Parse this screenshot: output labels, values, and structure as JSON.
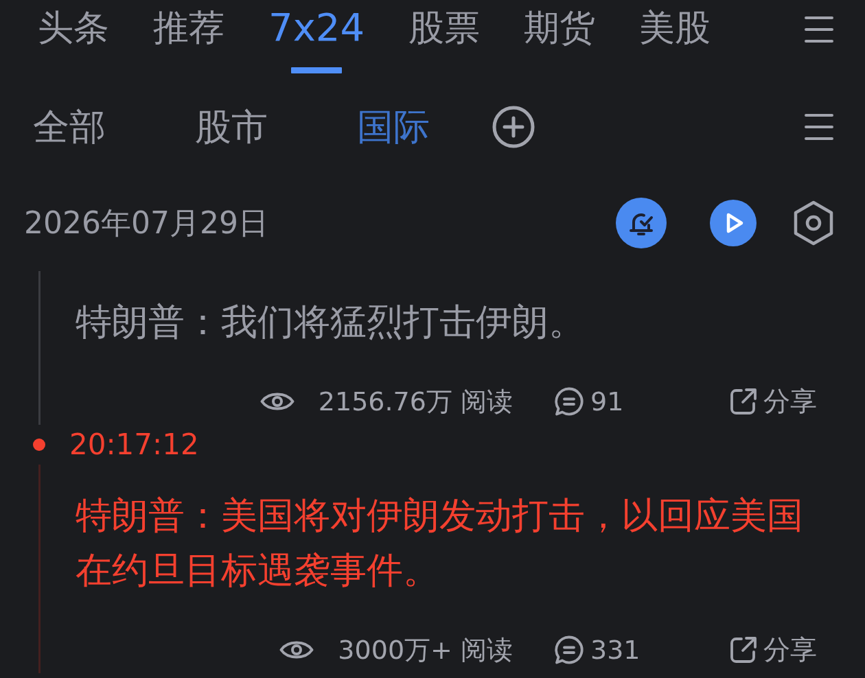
{
  "top_tabs": [
    {
      "label": "头条",
      "selected": false
    },
    {
      "label": "推荐",
      "selected": false
    },
    {
      "label": "7x24",
      "selected": true
    },
    {
      "label": "股票",
      "selected": false
    },
    {
      "label": "期货",
      "selected": false
    },
    {
      "label": "美股",
      "selected": false
    }
  ],
  "sub_tabs": [
    {
      "label": "全部",
      "selected": false
    },
    {
      "label": "股市",
      "selected": false
    },
    {
      "label": "国际",
      "selected": true
    }
  ],
  "date_bar": {
    "date": "2026年07月29日"
  },
  "feed": [
    {
      "important": false,
      "text": "特朗普：我们将猛烈打击伊朗。",
      "reads": "2156.76万 阅读",
      "comments": "91",
      "share": "分享"
    },
    {
      "time": "20:17:12",
      "important": true,
      "text": "特朗普：美国将对伊朗发动打击，以回应美国在约旦目标遇袭事件。",
      "reads": "3000万+ 阅读",
      "comments": "331",
      "share": "分享"
    }
  ]
}
